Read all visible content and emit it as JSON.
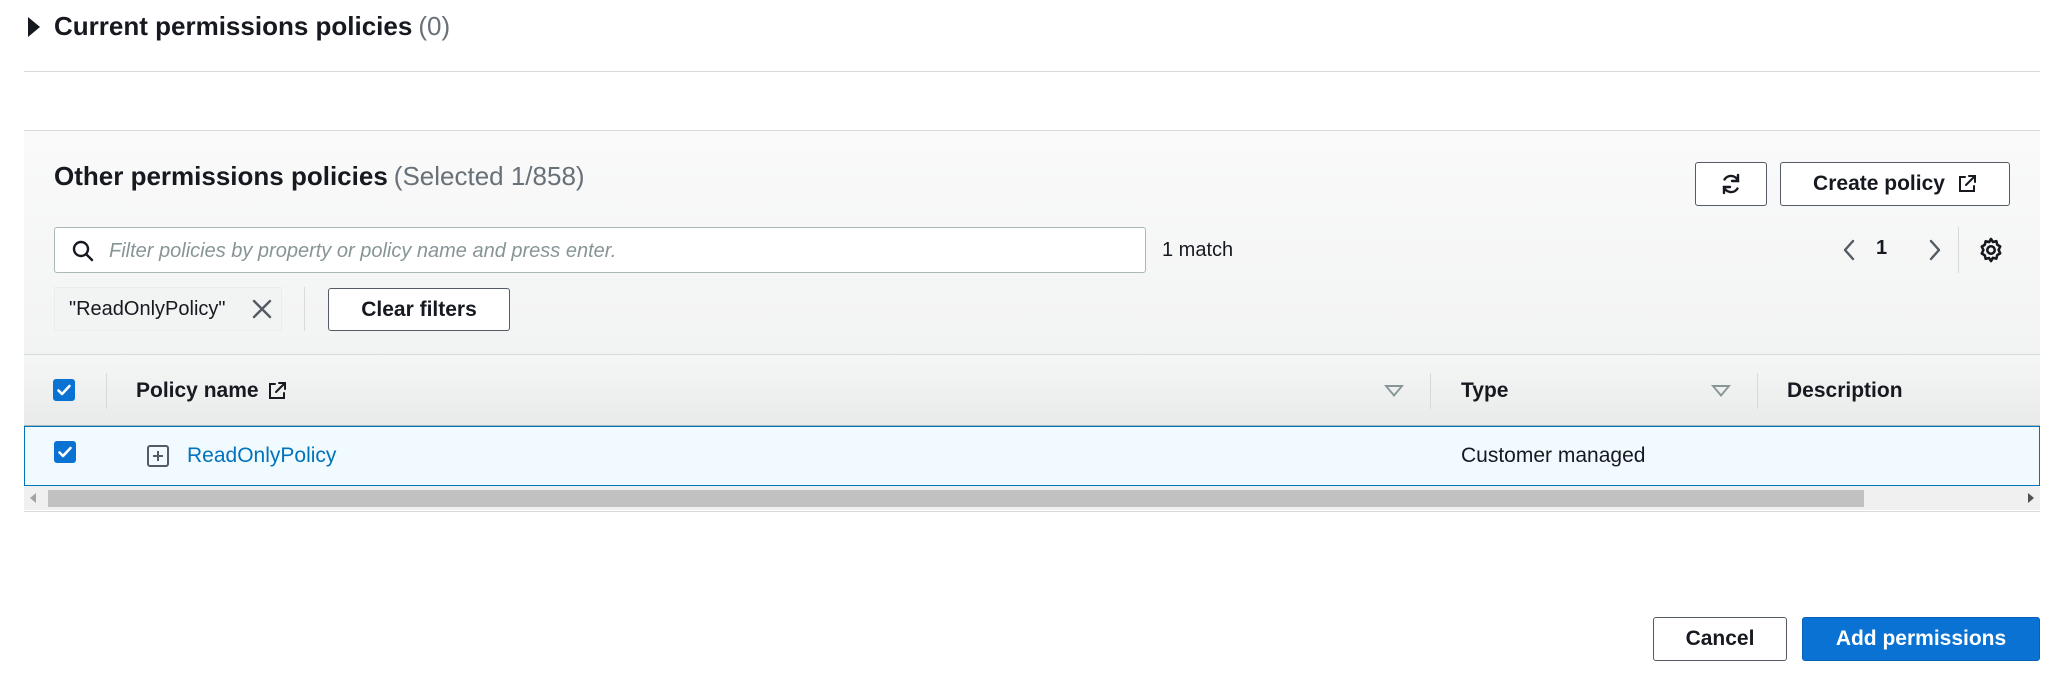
{
  "current_policies": {
    "title": "Current permissions policies",
    "count": "(0)"
  },
  "other_policies": {
    "title": "Other permissions policies",
    "selected": "(Selected 1/858)",
    "refresh_icon": "refresh-icon",
    "create_policy_label": "Create policy",
    "search": {
      "placeholder": "Filter policies by property or policy name and press enter."
    },
    "match_text": "1 match",
    "pagination": {
      "current_page": "1"
    },
    "filter_token": "\"ReadOnlyPolicy\"",
    "clear_filters_label": "Clear filters",
    "table": {
      "columns": [
        "Policy name",
        "Type",
        "Description"
      ],
      "rows": [
        {
          "selected": true,
          "policy_name": "ReadOnlyPolicy",
          "type": "Customer managed",
          "description": ""
        }
      ]
    }
  },
  "footer": {
    "cancel_label": "Cancel",
    "add_label": "Add permissions"
  },
  "colors": {
    "primary": "#0972d3",
    "link": "#0073bb",
    "selected_row_bg": "#f1faff"
  }
}
